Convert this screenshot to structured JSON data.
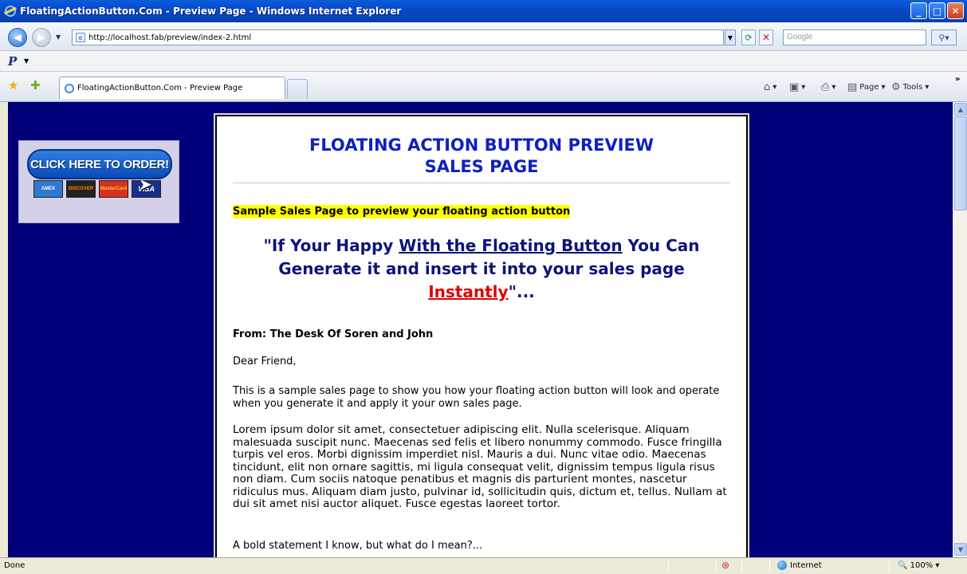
{
  "window": {
    "title": "FloatingActionButton.Com - Preview Page - Windows Internet Explorer",
    "minimize": "_",
    "maximize": "□",
    "close": "✕"
  },
  "address": {
    "url": "http://localhost.fab/preview/index-2.html",
    "search_placeholder": "Google"
  },
  "toolbar": {
    "tab_title": "FloatingActionButton.Com - Preview Page",
    "page_label": "Page",
    "tools_label": "Tools"
  },
  "sidebar": {
    "order_button": "CLICK HERE TO ORDER!",
    "cards": [
      "AMEX",
      "DISCOVER",
      "MasterCard",
      "VISA"
    ]
  },
  "content": {
    "title_line1": "FLOATING ACTION BUTTON PREVIEW",
    "title_line2": "SALES PAGE",
    "subheadline": "Sample Sales Page to preview your floating action button",
    "headline_part1": "\"If Your Happy ",
    "headline_link": "With the Floating Button",
    "headline_part2": " You Can Generate it and insert it into your sales page ",
    "headline_instantly": "Instantly",
    "headline_end": "\"...",
    "from": "From: The Desk Of Soren and John",
    "greeting": "Dear Friend,",
    "para1": "This is a sample sales page to show you how your floating action button will look and operate when you generate it and apply it your own sales page.",
    "para2": "Lorem ipsum dolor sit amet, consectetuer adipiscing elit. Nulla scelerisque. Aliquam malesuada suscipit nunc. Maecenas sed felis et libero nonummy commodo. Fusce fringilla turpis vel eros. Morbi dignissim imperdiet nisl. Mauris a dui. Nunc vitae odio. Maecenas tincidunt, elit non ornare sagittis, mi ligula consequat velit, dignissim tempus ligula risus non diam. Cum sociis natoque penatibus et magnis dis parturient montes, nascetur ridiculus mus. Aliquam diam justo, pulvinar id, sollicitudin quis, dictum et, tellus. Nullam at dui sit amet nisi auctor aliquet. Fusce egestas laoreet tortor.",
    "para3": "A bold statement I know, but what do I mean?..."
  },
  "status": {
    "text": "Done",
    "zone": "Internet",
    "zoom": "100%"
  }
}
